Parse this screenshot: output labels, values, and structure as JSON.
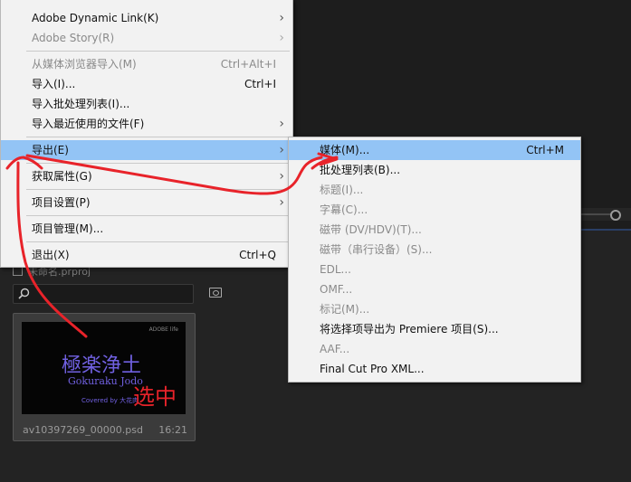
{
  "main_menu": {
    "items": [
      {
        "label": "Adobe Dynamic Link(K)",
        "shortcut": "",
        "submenu": true,
        "disabled": false
      },
      {
        "label": "Adobe Story(R)",
        "shortcut": "",
        "submenu": true,
        "disabled": true
      },
      {
        "label": "从媒体浏览器导入(M)",
        "shortcut": "Ctrl+Alt+I",
        "submenu": false,
        "disabled": true
      },
      {
        "label": "导入(I)...",
        "shortcut": "Ctrl+I",
        "submenu": false,
        "disabled": false
      },
      {
        "label": "导入批处理列表(I)...",
        "shortcut": "",
        "submenu": false,
        "disabled": false
      },
      {
        "label": "导入最近使用的文件(F)",
        "shortcut": "",
        "submenu": true,
        "disabled": false
      },
      {
        "label": "导出(E)",
        "shortcut": "",
        "submenu": true,
        "disabled": false,
        "highlighted": true
      },
      {
        "label": "获取属性(G)",
        "shortcut": "",
        "submenu": true,
        "disabled": false
      },
      {
        "label": "项目设置(P)",
        "shortcut": "",
        "submenu": true,
        "disabled": false
      },
      {
        "label": "项目管理(M)...",
        "shortcut": "",
        "submenu": false,
        "disabled": false
      },
      {
        "label": "退出(X)",
        "shortcut": "Ctrl+Q",
        "submenu": false,
        "disabled": false
      }
    ]
  },
  "export_submenu": {
    "items": [
      {
        "label": "媒体(M)...",
        "shortcut": "Ctrl+M",
        "disabled": false,
        "highlighted": true
      },
      {
        "label": "批处理列表(B)...",
        "shortcut": "",
        "disabled": false
      },
      {
        "label": "标题(I)...",
        "shortcut": "",
        "disabled": true
      },
      {
        "label": "字幕(C)...",
        "shortcut": "",
        "disabled": true
      },
      {
        "label": "磁带 (DV/HDV)(T)...",
        "shortcut": "",
        "disabled": true
      },
      {
        "label": "磁带（串行设备）(S)...",
        "shortcut": "",
        "disabled": true
      },
      {
        "label": "EDL...",
        "shortcut": "",
        "disabled": true
      },
      {
        "label": "OMF...",
        "shortcut": "",
        "disabled": true
      },
      {
        "label": "标记(M)...",
        "shortcut": "",
        "disabled": true
      },
      {
        "label": "将选择项导出为 Premiere 项目(S)...",
        "shortcut": "",
        "disabled": false
      },
      {
        "label": "AAF...",
        "shortcut": "",
        "disabled": true
      },
      {
        "label": "Final Cut Pro XML...",
        "shortcut": "",
        "disabled": false
      }
    ]
  },
  "project_panel": {
    "tab_label": "未命名.prproj",
    "search_placeholder": ""
  },
  "thumbnail": {
    "title_kanji": "極楽浄土",
    "romaji": "Gokuraku Jodo",
    "cover_text": "Covered by 大花肉",
    "corner_text": "ADOBE life",
    "filename": "av10397269_00000.psd",
    "duration": "16:21"
  },
  "annotation": {
    "text": "选中",
    "color": "#e8232a"
  },
  "colors": {
    "highlight": "#93c4f5",
    "menu_bg": "#f2f2f2"
  }
}
